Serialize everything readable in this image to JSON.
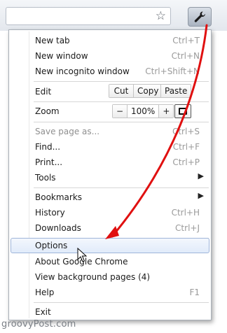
{
  "toolbar": {
    "star_icon": "star-outline-icon",
    "wrench_icon": "wrench-icon"
  },
  "menu": {
    "group1": [
      {
        "label": "New tab",
        "shortcut": "Ctrl+T"
      },
      {
        "label": "New window",
        "shortcut": "Ctrl+N"
      },
      {
        "label": "New incognito window",
        "shortcut": "Ctrl+Shift+N"
      }
    ],
    "edit": {
      "label": "Edit",
      "cut": "Cut",
      "copy": "Copy",
      "paste": "Paste"
    },
    "zoom": {
      "label": "Zoom",
      "minus": "−",
      "value": "100%",
      "plus": "+"
    },
    "group3": [
      {
        "label": "Save page as...",
        "shortcut": "Ctrl+S",
        "disabled": true
      },
      {
        "label": "Find...",
        "shortcut": "Ctrl+F"
      },
      {
        "label": "Print...",
        "shortcut": "Ctrl+P"
      },
      {
        "label": "Tools",
        "submenu": "▶"
      }
    ],
    "group4": [
      {
        "label": "Bookmarks",
        "submenu": "▶"
      },
      {
        "label": "History",
        "shortcut": "Ctrl+H"
      },
      {
        "label": "Downloads",
        "shortcut": "Ctrl+J"
      }
    ],
    "group5": [
      {
        "label": "Options"
      },
      {
        "label": "About Google Chrome"
      },
      {
        "label": "View background pages (4)"
      },
      {
        "label": "Help",
        "shortcut": "F1"
      }
    ],
    "exit": {
      "label": "Exit"
    }
  },
  "annotation": {
    "arrow_color": "#e01010"
  },
  "watermark": "groovyPost.com"
}
